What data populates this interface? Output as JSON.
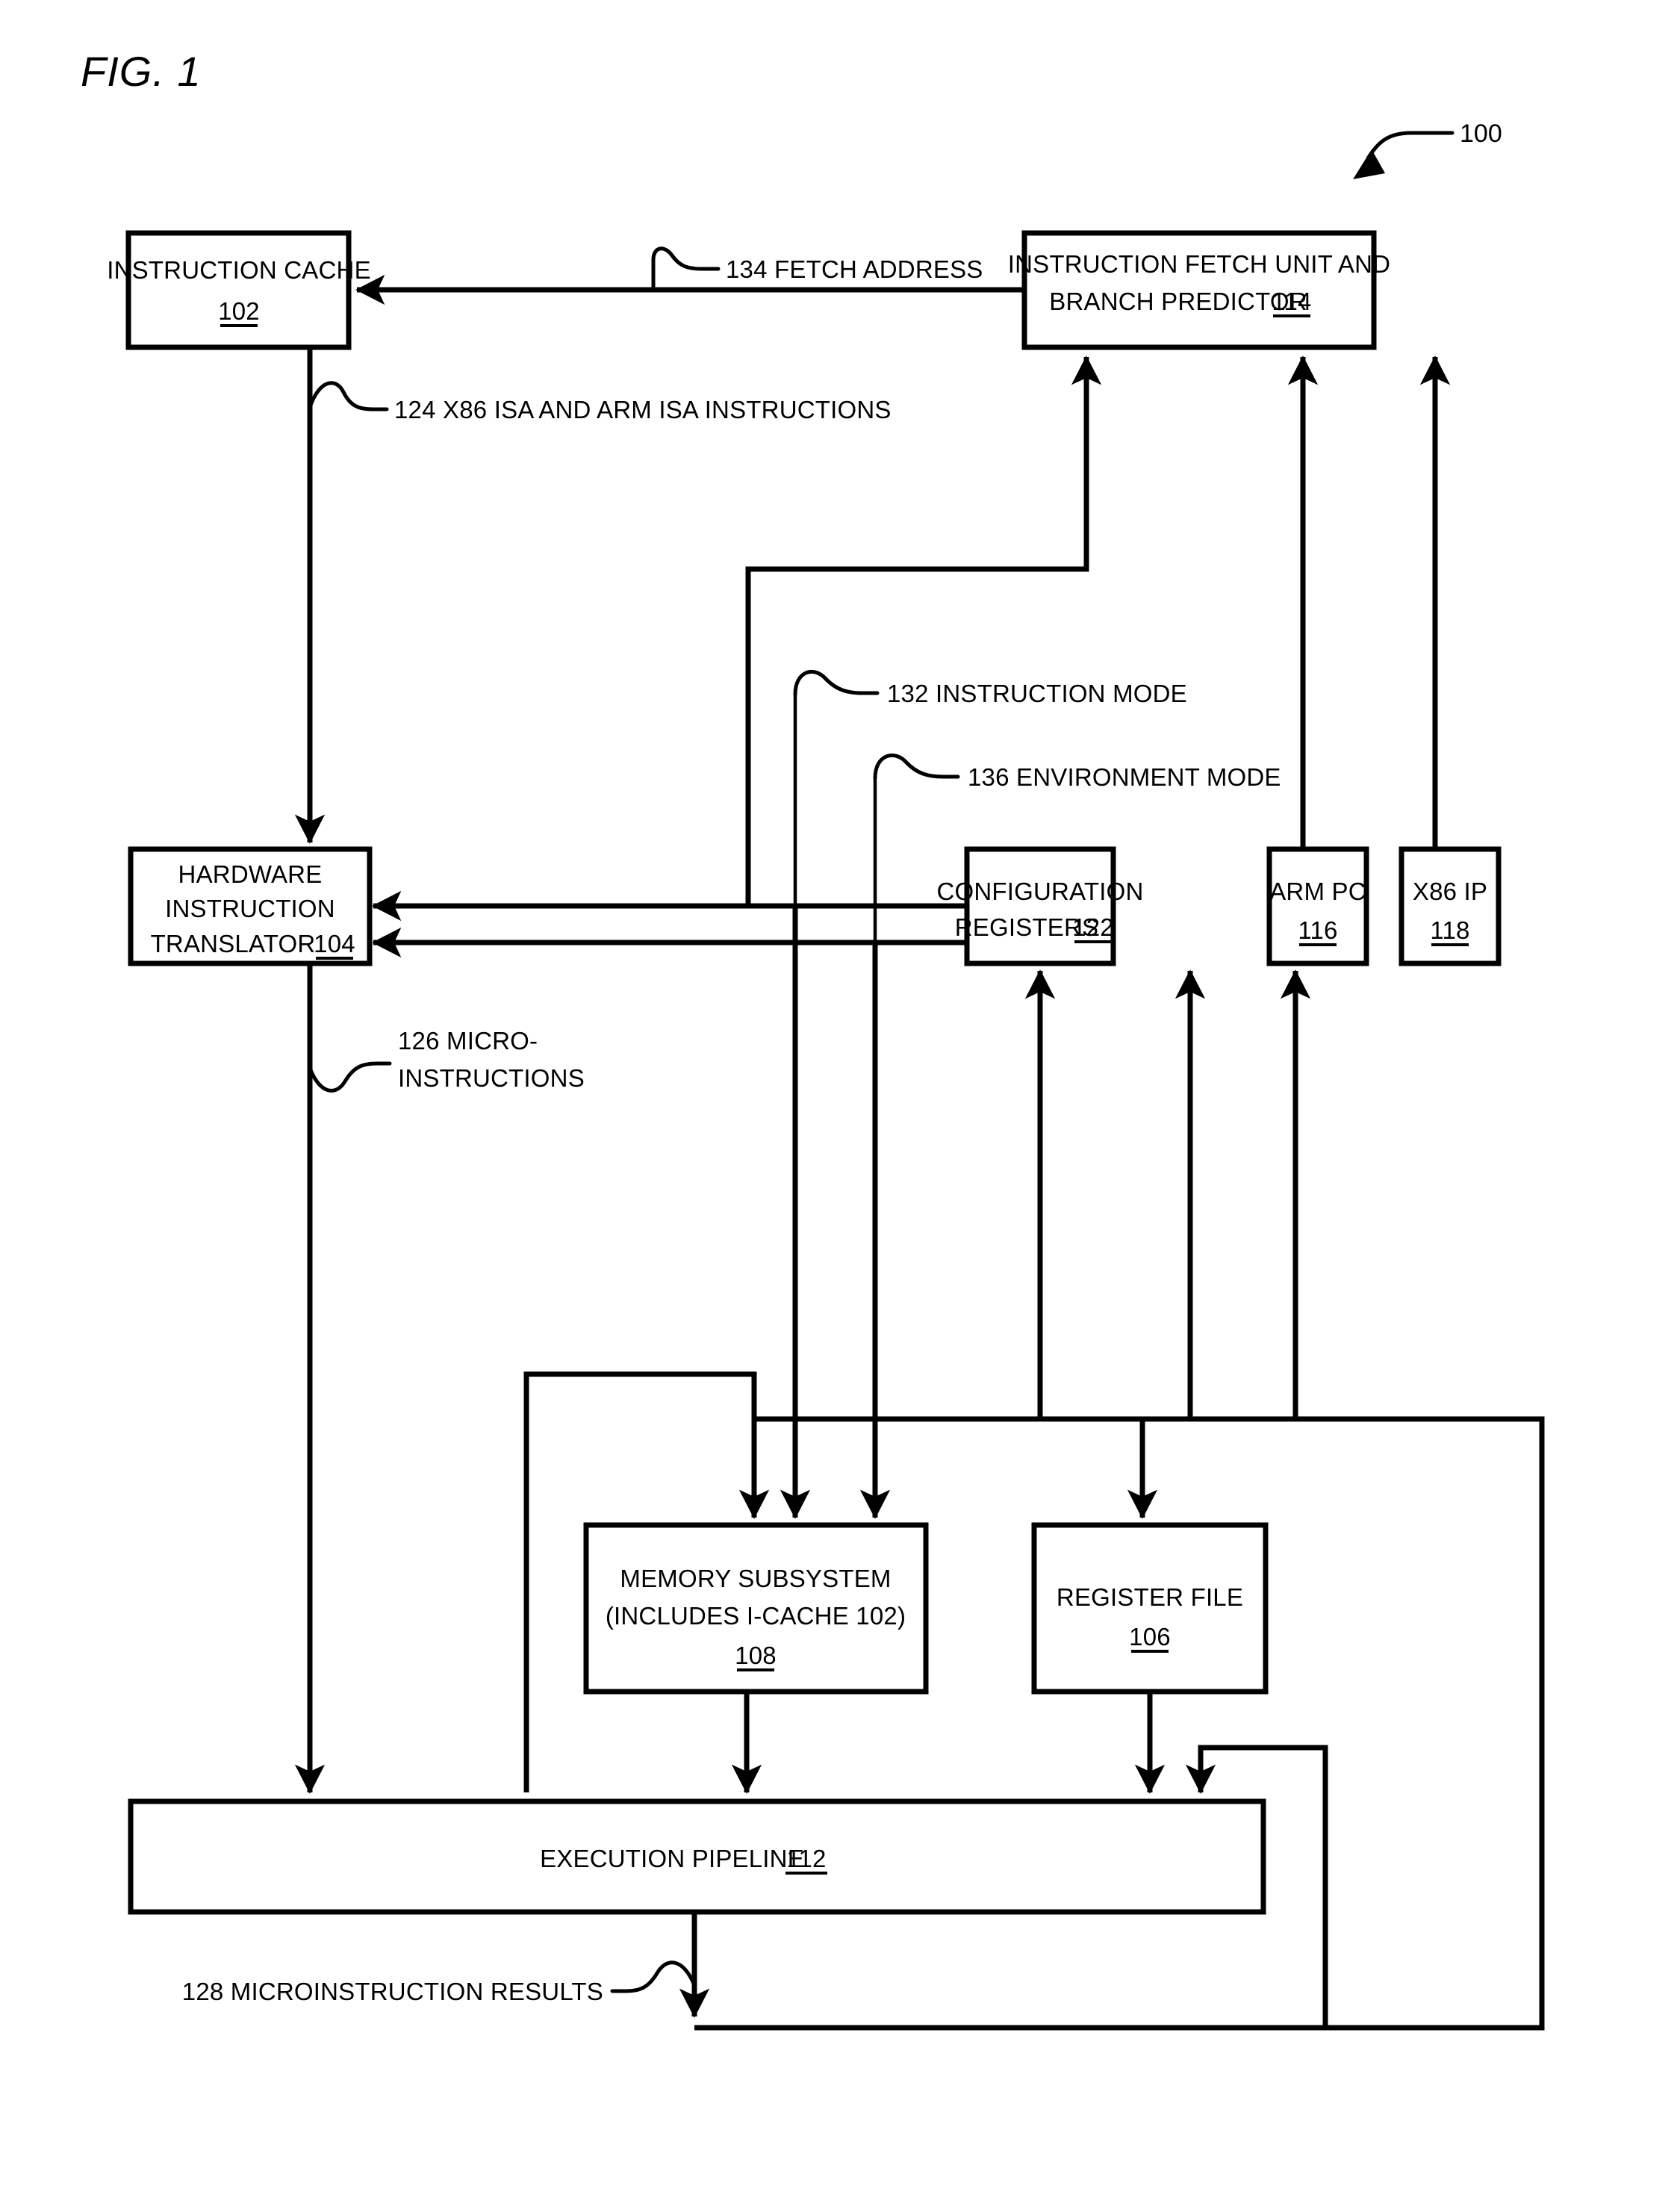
{
  "figure": {
    "title": "FIG. 1",
    "reference_numeral": "100"
  },
  "blocks": {
    "instruction_cache": {
      "line1": "INSTRUCTION CACHE",
      "ref": "102"
    },
    "instruction_fetch_unit": {
      "line1": "INSTRUCTION FETCH UNIT AND",
      "line2": "BRANCH PREDICTOR",
      "ref": "114"
    },
    "hardware_instruction_translator": {
      "line1": "HARDWARE",
      "line2": "INSTRUCTION",
      "line3": "TRANSLATOR",
      "ref": "104"
    },
    "configuration_registers": {
      "line1": "CONFIGURATION",
      "line2": "REGISTERS",
      "ref": "122"
    },
    "arm_pc": {
      "line1": "ARM PC",
      "ref": "116"
    },
    "x86_ip": {
      "line1": "X86 IP",
      "ref": "118"
    },
    "memory_subsystem": {
      "line1": "MEMORY SUBSYSTEM",
      "line2": "(INCLUDES I-CACHE 102)",
      "ref": "108"
    },
    "register_file": {
      "line1": "REGISTER FILE",
      "ref": "106"
    },
    "execution_pipeline": {
      "line1": "EXECUTION PIPELINE",
      "ref": "112"
    }
  },
  "signal_labels": {
    "fetch_address": "134 FETCH ADDRESS",
    "isa_instructions": "124 X86 ISA AND ARM ISA INSTRUCTIONS",
    "instruction_mode": "132 INSTRUCTION MODE",
    "environment_mode": "136 ENVIRONMENT MODE",
    "microinstructions_line1": "126 MICRO-",
    "microinstructions_line2": "INSTRUCTIONS",
    "microinstruction_results": "128 MICROINSTRUCTION RESULTS"
  },
  "colors": {
    "line": "#000000",
    "fill": "#ffffff",
    "text": "#000000"
  }
}
